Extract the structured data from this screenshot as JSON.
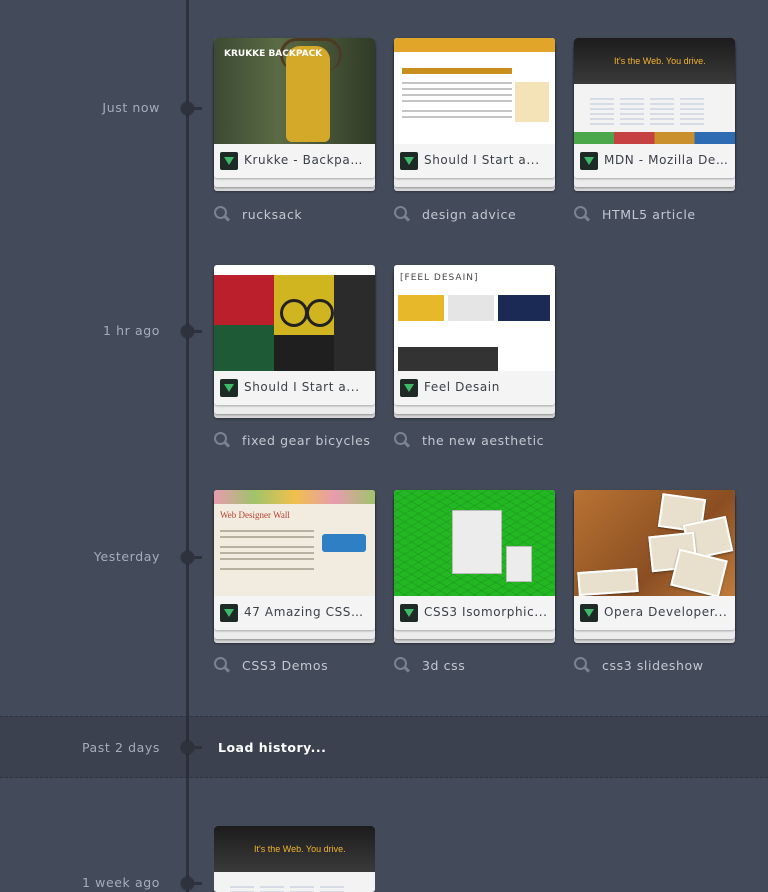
{
  "sections": [
    {
      "label": "Just now",
      "cards": [
        {
          "title": "Krukke - Backpack..."
        },
        {
          "title": "Should I Start a..."
        },
        {
          "title": "MDN - Mozilla De..."
        }
      ],
      "queries": [
        "rucksack",
        "design advice",
        "HTML5 article"
      ]
    },
    {
      "label": "1 hr ago",
      "cards": [
        {
          "title": "Should I Start a..."
        },
        {
          "title": "Feel Desain"
        }
      ],
      "queries": [
        "fixed gear bicycles",
        "the new aesthetic"
      ]
    },
    {
      "label": "Yesterday",
      "cards": [
        {
          "title": "47 Amazing CSS3..."
        },
        {
          "title": "CSS3 Isomorphic..."
        },
        {
          "title": "Opera Developer..."
        }
      ],
      "queries": [
        "CSS3 Demos",
        "3d css",
        "css3 slideshow"
      ]
    }
  ],
  "history": {
    "label": "Past 2 days",
    "action": "Load history..."
  },
  "older": {
    "label": "1 week ago"
  },
  "thumbs": {
    "backpack_logo": "KRUKKE BACKPACK",
    "mdn_hero": "It's the Web. You drive.",
    "feel_header": "[FEEL DESAIN]",
    "wall_header": "Web Designer Wall"
  },
  "colors": {
    "background": "#434a59",
    "timeline": "#2d323c",
    "favicon_green": "#3fb86a"
  }
}
